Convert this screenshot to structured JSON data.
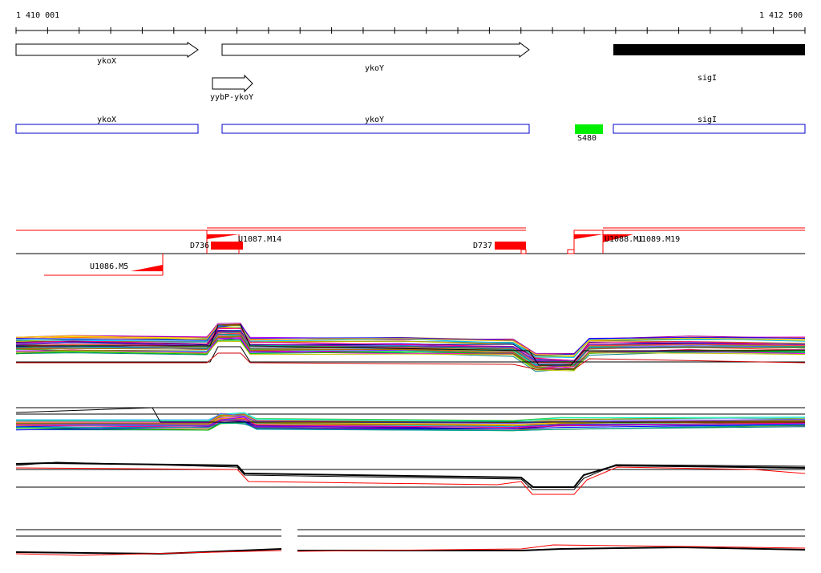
{
  "coordinate_axis": {
    "start_label": "1 410 001",
    "end_label": "1 412 500"
  },
  "genes": [
    {
      "name": "ykoX",
      "style": "open-arrow"
    },
    {
      "name": "ykoY",
      "style": "open-arrow"
    },
    {
      "name": "sigI",
      "style": "filled-bar"
    }
  ],
  "operons": [
    {
      "name": "yybP-ykoY",
      "style": "open-arrow"
    }
  ],
  "transcription_units": [
    {
      "name": "ykoX"
    },
    {
      "name": "ykoY"
    },
    {
      "name": "sigI"
    }
  ],
  "small_features": [
    {
      "name": "S480",
      "color": "#00ee00"
    }
  ],
  "segments": [
    {
      "name": "D736",
      "color": "#ff0000"
    },
    {
      "name": "U1087.M14",
      "color": "#ff0000"
    },
    {
      "name": "D737",
      "color": "#ff0000"
    },
    {
      "name": "U1088.M1",
      "color": "#ff0000"
    },
    {
      "name": "U1089.M19",
      "color": "#ff0000"
    },
    {
      "name": "U1086.M5",
      "color": "#ff0000"
    }
  ],
  "colors": {
    "gene_outline": "#000000",
    "transcription_unit_outline": "#0000cc",
    "segment_red": "#ff0000",
    "small_feature_green": "#00ee00"
  },
  "expression_panels": [
    {
      "name": "panel-1",
      "profile_count": 40
    },
    {
      "name": "panel-2",
      "profile_count": 30
    },
    {
      "name": "panel-3",
      "profile_count": 3
    },
    {
      "name": "panel-4",
      "profile_count": 2
    }
  ]
}
